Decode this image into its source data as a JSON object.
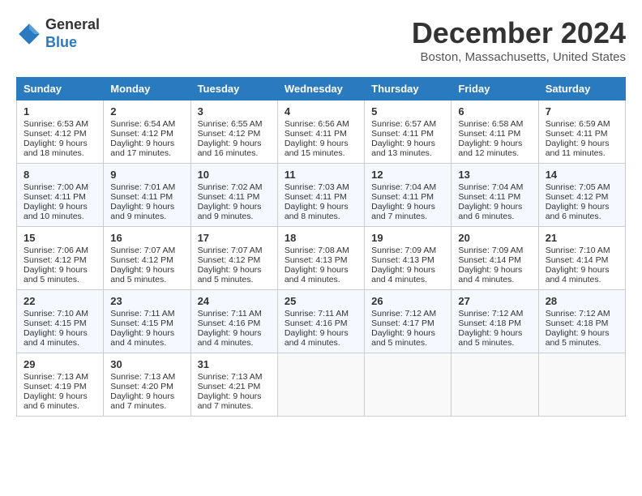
{
  "header": {
    "logo_general": "General",
    "logo_blue": "Blue",
    "month_title": "December 2024",
    "location": "Boston, Massachusetts, United States"
  },
  "days_of_week": [
    "Sunday",
    "Monday",
    "Tuesday",
    "Wednesday",
    "Thursday",
    "Friday",
    "Saturday"
  ],
  "weeks": [
    [
      {
        "day": "1",
        "sunrise": "6:53 AM",
        "sunset": "4:12 PM",
        "daylight": "9 hours and 18 minutes."
      },
      {
        "day": "2",
        "sunrise": "6:54 AM",
        "sunset": "4:12 PM",
        "daylight": "9 hours and 17 minutes."
      },
      {
        "day": "3",
        "sunrise": "6:55 AM",
        "sunset": "4:12 PM",
        "daylight": "9 hours and 16 minutes."
      },
      {
        "day": "4",
        "sunrise": "6:56 AM",
        "sunset": "4:11 PM",
        "daylight": "9 hours and 15 minutes."
      },
      {
        "day": "5",
        "sunrise": "6:57 AM",
        "sunset": "4:11 PM",
        "daylight": "9 hours and 13 minutes."
      },
      {
        "day": "6",
        "sunrise": "6:58 AM",
        "sunset": "4:11 PM",
        "daylight": "9 hours and 12 minutes."
      },
      {
        "day": "7",
        "sunrise": "6:59 AM",
        "sunset": "4:11 PM",
        "daylight": "9 hours and 11 minutes."
      }
    ],
    [
      {
        "day": "8",
        "sunrise": "7:00 AM",
        "sunset": "4:11 PM",
        "daylight": "9 hours and 10 minutes."
      },
      {
        "day": "9",
        "sunrise": "7:01 AM",
        "sunset": "4:11 PM",
        "daylight": "9 hours and 9 minutes."
      },
      {
        "day": "10",
        "sunrise": "7:02 AM",
        "sunset": "4:11 PM",
        "daylight": "9 hours and 9 minutes."
      },
      {
        "day": "11",
        "sunrise": "7:03 AM",
        "sunset": "4:11 PM",
        "daylight": "9 hours and 8 minutes."
      },
      {
        "day": "12",
        "sunrise": "7:04 AM",
        "sunset": "4:11 PM",
        "daylight": "9 hours and 7 minutes."
      },
      {
        "day": "13",
        "sunrise": "7:04 AM",
        "sunset": "4:11 PM",
        "daylight": "9 hours and 6 minutes."
      },
      {
        "day": "14",
        "sunrise": "7:05 AM",
        "sunset": "4:12 PM",
        "daylight": "9 hours and 6 minutes."
      }
    ],
    [
      {
        "day": "15",
        "sunrise": "7:06 AM",
        "sunset": "4:12 PM",
        "daylight": "9 hours and 5 minutes."
      },
      {
        "day": "16",
        "sunrise": "7:07 AM",
        "sunset": "4:12 PM",
        "daylight": "9 hours and 5 minutes."
      },
      {
        "day": "17",
        "sunrise": "7:07 AM",
        "sunset": "4:12 PM",
        "daylight": "9 hours and 5 minutes."
      },
      {
        "day": "18",
        "sunrise": "7:08 AM",
        "sunset": "4:13 PM",
        "daylight": "9 hours and 4 minutes."
      },
      {
        "day": "19",
        "sunrise": "7:09 AM",
        "sunset": "4:13 PM",
        "daylight": "9 hours and 4 minutes."
      },
      {
        "day": "20",
        "sunrise": "7:09 AM",
        "sunset": "4:14 PM",
        "daylight": "9 hours and 4 minutes."
      },
      {
        "day": "21",
        "sunrise": "7:10 AM",
        "sunset": "4:14 PM",
        "daylight": "9 hours and 4 minutes."
      }
    ],
    [
      {
        "day": "22",
        "sunrise": "7:10 AM",
        "sunset": "4:15 PM",
        "daylight": "9 hours and 4 minutes."
      },
      {
        "day": "23",
        "sunrise": "7:11 AM",
        "sunset": "4:15 PM",
        "daylight": "9 hours and 4 minutes."
      },
      {
        "day": "24",
        "sunrise": "7:11 AM",
        "sunset": "4:16 PM",
        "daylight": "9 hours and 4 minutes."
      },
      {
        "day": "25",
        "sunrise": "7:11 AM",
        "sunset": "4:16 PM",
        "daylight": "9 hours and 4 minutes."
      },
      {
        "day": "26",
        "sunrise": "7:12 AM",
        "sunset": "4:17 PM",
        "daylight": "9 hours and 5 minutes."
      },
      {
        "day": "27",
        "sunrise": "7:12 AM",
        "sunset": "4:18 PM",
        "daylight": "9 hours and 5 minutes."
      },
      {
        "day": "28",
        "sunrise": "7:12 AM",
        "sunset": "4:18 PM",
        "daylight": "9 hours and 5 minutes."
      }
    ],
    [
      {
        "day": "29",
        "sunrise": "7:13 AM",
        "sunset": "4:19 PM",
        "daylight": "9 hours and 6 minutes."
      },
      {
        "day": "30",
        "sunrise": "7:13 AM",
        "sunset": "4:20 PM",
        "daylight": "9 hours and 7 minutes."
      },
      {
        "day": "31",
        "sunrise": "7:13 AM",
        "sunset": "4:21 PM",
        "daylight": "9 hours and 7 minutes."
      },
      null,
      null,
      null,
      null
    ]
  ],
  "labels": {
    "sunrise": "Sunrise:",
    "sunset": "Sunset:",
    "daylight": "Daylight:"
  }
}
